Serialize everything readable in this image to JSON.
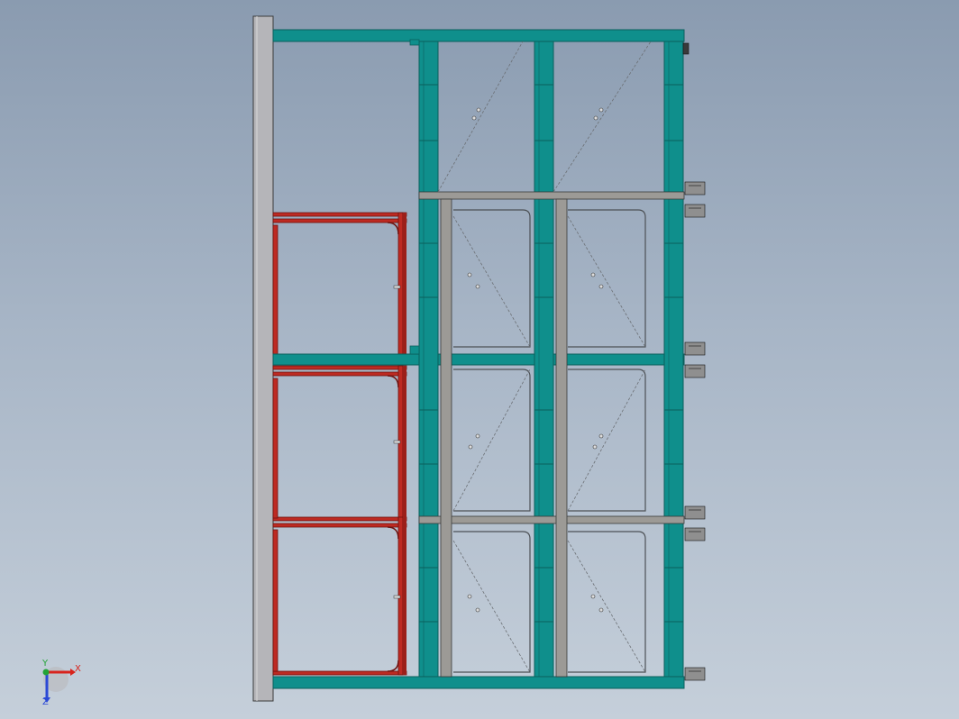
{
  "view": {
    "background_top": "#8a9bb0",
    "background_bottom": "#c5cfda"
  },
  "colors": {
    "wall_panel": "#b5b5b9",
    "frame_teal": "#0f8f8c",
    "frame_teal_dark": "#0b5f5d",
    "frame_red": "#bd2a22",
    "frame_red_dark": "#6e1310",
    "steel_gray": "#9c9a96",
    "steel_dark": "#3a3a3a",
    "wire": "#6b6f74"
  },
  "triad": {
    "x_label": "X",
    "y_label": "Y",
    "z_label": "Z",
    "x_color": "#d8231c",
    "y_color": "#22a336",
    "z_color": "#2b49d6"
  }
}
